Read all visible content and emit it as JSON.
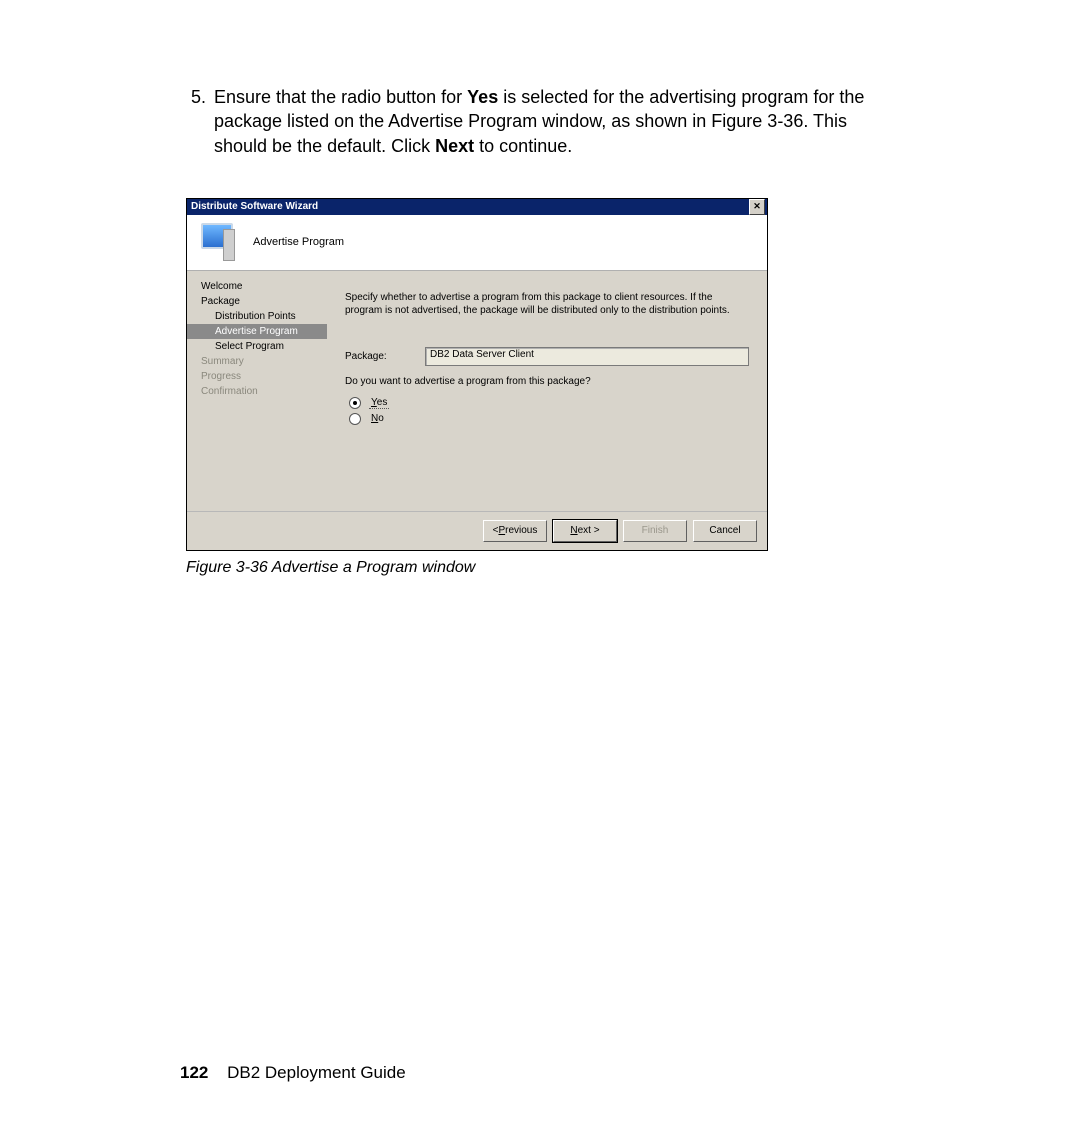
{
  "step": {
    "number": "5.",
    "line1a": "Ensure that the radio button for ",
    "line1_bold": "Yes",
    "line1b": " is selected for the advertising program for ",
    "line2": "the package listed on the Advertise Program window, as shown in ",
    "line3a": "Figure 3-36. This should be the default. Click ",
    "line3_bold": "Next",
    "line3b": " to continue."
  },
  "wizard": {
    "title": "Distribute Software Wizard",
    "banner": "Advertise Program",
    "nav": {
      "welcome": "Welcome",
      "package": "Package",
      "distribution": "Distribution Points",
      "advertise": "Advertise Program",
      "select": "Select Program",
      "summary": "Summary",
      "progress": "Progress",
      "confirmation": "Confirmation"
    },
    "description": "Specify whether to advertise a program from this package to client resources.  If the program is not advertised, the package will be distributed only to the distribution points.",
    "package_label": "Package:",
    "package_value": "DB2 Data Server Client",
    "question": "Do you want to advertise a program from this package?",
    "yes_prefix": "Y",
    "yes_rest": "es",
    "no_prefix": "N",
    "no_rest": "o",
    "buttons": {
      "previous_prefix": "< ",
      "previous_u": "P",
      "previous_rest": "revious",
      "next_u": "N",
      "next_rest": "ext >",
      "finish": "Finish",
      "cancel": "Cancel"
    }
  },
  "caption": "Figure 3-36   Advertise a Program window",
  "footer": {
    "page": "122",
    "title": "DB2 Deployment Guide"
  }
}
